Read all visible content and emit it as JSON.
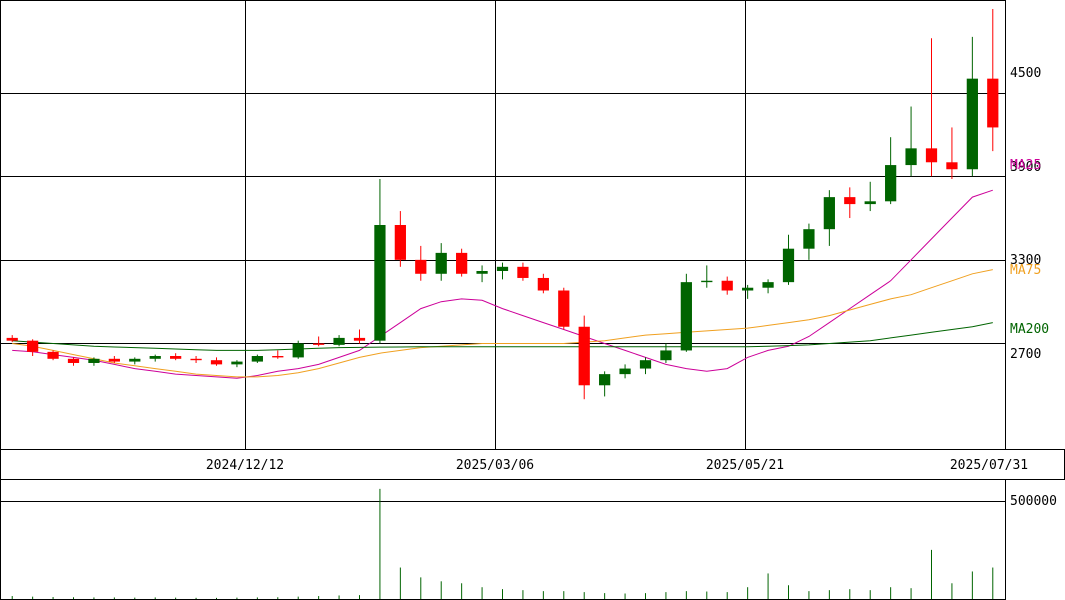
{
  "chart_data": [
    {
      "type": "candlestick",
      "ylim": [
        1950,
        5150
      ],
      "ytick_values": [
        2700,
        3300,
        3900,
        4500
      ],
      "ytick_labels": [
        "2700",
        "3300",
        "3900",
        "4500"
      ],
      "xtick_labels": [
        "2024/12/12",
        "2025/03/06",
        "2025/05/21",
        "2025/07/31"
      ],
      "colors": {
        "up": "#006400",
        "down": "#ff0000",
        "ma25": "#cc0099",
        "ma75": "#f0a020",
        "ma200": "#006400",
        "grid": "#000000"
      },
      "moving_averages": [
        {
          "name": "MA25",
          "values": [
            2650,
            2640,
            2620,
            2600,
            2580,
            2550,
            2520,
            2500,
            2480,
            2470,
            2460,
            2450,
            2470,
            2500,
            2520,
            2550,
            2600,
            2650,
            2750,
            2850,
            2950,
            3000,
            3020,
            3010,
            2950,
            2900,
            2850,
            2800,
            2750,
            2700,
            2650,
            2600,
            2550,
            2520,
            2500,
            2520,
            2600,
            2650,
            2680,
            2750,
            2850,
            2950,
            3050,
            3150,
            3300,
            3450,
            3600,
            3750,
            3800
          ]
        },
        {
          "name": "MA75",
          "values": [
            2700,
            2680,
            2650,
            2620,
            2590,
            2560,
            2540,
            2520,
            2500,
            2480,
            2470,
            2460,
            2460,
            2470,
            2490,
            2520,
            2560,
            2600,
            2630,
            2650,
            2670,
            2680,
            2690,
            2700,
            2700,
            2700,
            2700,
            2700,
            2710,
            2720,
            2740,
            2760,
            2770,
            2780,
            2790,
            2800,
            2810,
            2830,
            2850,
            2870,
            2900,
            2940,
            2980,
            3020,
            3050,
            3100,
            3150,
            3200,
            3230
          ]
        },
        {
          "name": "MA200",
          "values": [
            2720,
            2710,
            2700,
            2690,
            2680,
            2675,
            2670,
            2665,
            2660,
            2655,
            2650,
            2650,
            2650,
            2655,
            2660,
            2665,
            2670,
            2672,
            2674,
            2675,
            2676,
            2676,
            2676,
            2676,
            2676,
            2676,
            2676,
            2676,
            2676,
            2676,
            2676,
            2676,
            2676,
            2676,
            2676,
            2676,
            2677,
            2680,
            2685,
            2690,
            2700,
            2710,
            2720,
            2740,
            2760,
            2780,
            2800,
            2820,
            2850
          ]
        }
      ],
      "candles": [
        [
          2740,
          2760,
          2710,
          2720
        ],
        [
          2720,
          2730,
          2610,
          2640
        ],
        [
          2640,
          2650,
          2580,
          2590
        ],
        [
          2590,
          2600,
          2540,
          2560
        ],
        [
          2560,
          2600,
          2540,
          2590
        ],
        [
          2590,
          2610,
          2560,
          2570
        ],
        [
          2570,
          2600,
          2550,
          2590
        ],
        [
          2590,
          2620,
          2570,
          2610
        ],
        [
          2610,
          2630,
          2580,
          2590
        ],
        [
          2590,
          2610,
          2560,
          2580
        ],
        [
          2580,
          2600,
          2540,
          2550
        ],
        [
          2550,
          2580,
          2530,
          2570
        ],
        [
          2570,
          2620,
          2560,
          2610
        ],
        [
          2610,
          2650,
          2590,
          2600
        ],
        [
          2600,
          2720,
          2590,
          2700
        ],
        [
          2700,
          2750,
          2680,
          2690
        ],
        [
          2690,
          2760,
          2680,
          2740
        ],
        [
          2740,
          2800,
          2700,
          2720
        ],
        [
          2720,
          3880,
          2700,
          3550
        ],
        [
          3550,
          3650,
          3250,
          3300
        ],
        [
          3300,
          3400,
          3150,
          3200
        ],
        [
          3200,
          3420,
          3150,
          3350
        ],
        [
          3350,
          3380,
          3180,
          3200
        ],
        [
          3200,
          3260,
          3140,
          3220
        ],
        [
          3220,
          3280,
          3160,
          3250
        ],
        [
          3250,
          3280,
          3150,
          3170
        ],
        [
          3170,
          3200,
          3060,
          3080
        ],
        [
          3080,
          3100,
          2800,
          2820
        ],
        [
          2820,
          2900,
          2300,
          2400
        ],
        [
          2400,
          2500,
          2320,
          2480
        ],
        [
          2480,
          2550,
          2450,
          2520
        ],
        [
          2520,
          2600,
          2480,
          2580
        ],
        [
          2580,
          2700,
          2560,
          2650
        ],
        [
          2650,
          3200,
          2640,
          3140
        ],
        [
          3140,
          3260,
          3100,
          3150
        ],
        [
          3150,
          3180,
          3050,
          3080
        ],
        [
          3080,
          3120,
          3020,
          3100
        ],
        [
          3100,
          3160,
          3060,
          3140
        ],
        [
          3140,
          3480,
          3120,
          3380
        ],
        [
          3380,
          3560,
          3300,
          3520
        ],
        [
          3520,
          3800,
          3400,
          3750
        ],
        [
          3750,
          3820,
          3600,
          3700
        ],
        [
          3700,
          3860,
          3650,
          3720
        ],
        [
          3720,
          4180,
          3700,
          3980
        ],
        [
          3980,
          4400,
          3900,
          4100
        ],
        [
          4100,
          4890,
          3900,
          4000
        ],
        [
          4000,
          4250,
          3880,
          3950
        ],
        [
          3950,
          4900,
          3900,
          4600
        ],
        [
          4600,
          5100,
          4080,
          4250
        ]
      ]
    },
    {
      "type": "bar",
      "ylim": [
        0,
        600000
      ],
      "ytick_values": [
        500000
      ],
      "ytick_labels": [
        "500000"
      ],
      "values": [
        15000,
        12000,
        10000,
        9000,
        8000,
        8000,
        7000,
        8000,
        7000,
        6000,
        6000,
        7000,
        8000,
        9000,
        12000,
        15000,
        18000,
        20000,
        560000,
        160000,
        110000,
        90000,
        80000,
        60000,
        50000,
        45000,
        40000,
        40000,
        35000,
        30000,
        28000,
        30000,
        35000,
        40000,
        38000,
        35000,
        60000,
        130000,
        70000,
        40000,
        45000,
        50000,
        45000,
        60000,
        55000,
        250000,
        80000,
        140000,
        160000
      ]
    }
  ]
}
